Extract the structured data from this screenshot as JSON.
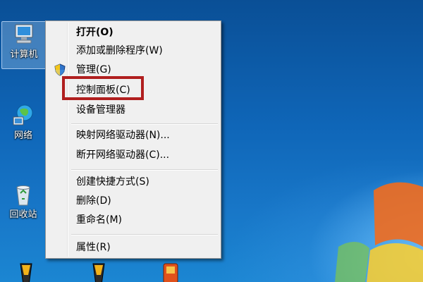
{
  "desktop_icons": [
    {
      "label": "计算机",
      "icon": "computer-icon"
    },
    {
      "label": "网络",
      "icon": "network-icon"
    },
    {
      "label": "回收站",
      "icon": "recycle-bin-icon"
    },
    {
      "label": "",
      "icon": "program-shortcut-icon"
    },
    {
      "label": "",
      "icon": "program-shortcut-icon"
    },
    {
      "label": "",
      "icon": "program-shortcut-icon"
    }
  ],
  "context_menu": {
    "items": [
      {
        "label": "打开(O)",
        "bold": true
      },
      {
        "label": "添加或删除程序(W)"
      },
      {
        "label": "管理(G)",
        "icon": "shield-icon"
      },
      {
        "label": "控制面板(C)",
        "highlighted": true
      },
      {
        "label": "设备管理器"
      },
      {
        "label": "映射网络驱动器(N)..."
      },
      {
        "label": "断开网络驱动器(C)..."
      },
      {
        "label": "创建快捷方式(S)"
      },
      {
        "label": "删除(D)"
      },
      {
        "label": "重命名(M)"
      },
      {
        "label": "属性(R)"
      }
    ]
  },
  "colors": {
    "highlight_border": "#b01e1e",
    "menu_background": "#f0f0f0",
    "desktop_blue": "#0f66b8"
  }
}
